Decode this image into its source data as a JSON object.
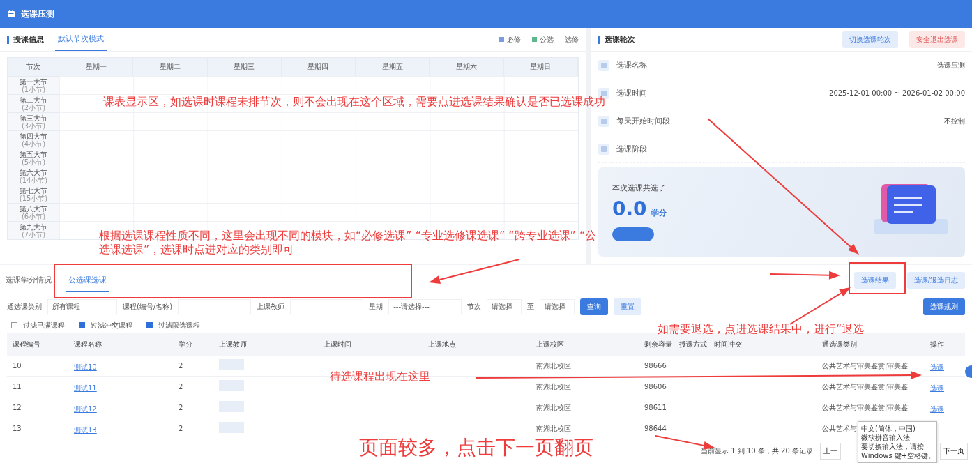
{
  "app": {
    "title": "选课压测"
  },
  "schedule": {
    "title": "授课信息",
    "tabs": [
      {
        "label": "默认节次模式",
        "selected": true
      }
    ],
    "legend": [
      {
        "label": "必修",
        "color": "#7b9be0"
      },
      {
        "label": "公选",
        "color": "#5cb88a"
      }
    ],
    "legend_extra": "选修",
    "corner": "节次",
    "days": [
      "星期一",
      "星期二",
      "星期三",
      "星期四",
      "星期五",
      "星期六",
      "星期日"
    ],
    "periods": [
      {
        "name": "第一大节",
        "sub": "(1小节)"
      },
      {
        "name": "第二大节",
        "sub": "(2小节)"
      },
      {
        "name": "第三大节",
        "sub": "(3小节)"
      },
      {
        "name": "第四大节",
        "sub": "(4小节)"
      },
      {
        "name": "第五大节",
        "sub": "(5小节)"
      },
      {
        "name": "第六大节",
        "sub": "(14小节)"
      },
      {
        "name": "第七大节",
        "sub": "(15小节)"
      },
      {
        "name": "第八大节",
        "sub": "(6小节)"
      },
      {
        "name": "第九大节",
        "sub": "(7小节)"
      }
    ]
  },
  "round": {
    "title": "选课轮次",
    "buttons": [
      {
        "label": "切换选课轮次",
        "kind": "primary"
      },
      {
        "label": "安全退出选课",
        "kind": "danger"
      }
    ],
    "info": [
      {
        "label": "选课名称",
        "value": "选课压测"
      },
      {
        "label": "选课时间",
        "value": "2025-12-01 00:00 ~ 2026-01-02 00:00"
      },
      {
        "label": "每天开始时间段",
        "value": "不控制"
      },
      {
        "label": "选课阶段"
      }
    ],
    "summary": {
      "caption": "本次选课共选了",
      "credits": "0.0",
      "unit": "学分"
    }
  },
  "course_selection": {
    "tabs": [
      {
        "label": "选课学分情况",
        "selected": false
      },
      {
        "label": "公选课选课",
        "selected": true
      }
    ],
    "actions": [
      "选课结果",
      "选课/退选日志"
    ],
    "filters": [
      {
        "kind": "select",
        "label": "通选课类别",
        "value": "所有课程"
      },
      {
        "kind": "input",
        "label": "课程(编号/名称)"
      },
      {
        "kind": "input",
        "label": "上课教师"
      },
      {
        "kind": "select",
        "label": "星期",
        "value": "---请选择---"
      },
      {
        "kind": "range",
        "label": "节次",
        "from": "请选择",
        "separator": "至",
        "to": "请选择"
      }
    ],
    "query": "查询",
    "reset": "重置",
    "rules": "选课规则",
    "checks": [
      {
        "label": "过滤已满课程",
        "checked": false
      },
      {
        "label": "过滤冲突课程",
        "checked": true
      },
      {
        "label": "过滤限选课程",
        "checked": true
      }
    ],
    "columns": [
      "课程编号",
      "课程名称",
      "学分",
      "上课教师",
      "上课时间",
      "上课地点",
      "上课校区",
      "剩余容量",
      "授课方式",
      "时间冲突",
      "通选课类别",
      "操作"
    ],
    "rows": [
      {
        "code": "10",
        "name": "测试10",
        "credit": "2",
        "campus": "南湖北校区",
        "remaining": "98666",
        "category": "公共艺术与审美鉴赏|审美鉴",
        "action": "选课"
      },
      {
        "code": "11",
        "name": "测试11",
        "credit": "2",
        "campus": "南湖北校区",
        "remaining": "98606",
        "category": "公共艺术与审美鉴赏|审美鉴",
        "action": "选课"
      },
      {
        "code": "12",
        "name": "测试12",
        "credit": "2",
        "campus": "南湖北校区",
        "remaining": "98611",
        "category": "公共艺术与审美鉴赏|审美鉴",
        "action": "选课"
      },
      {
        "code": "13",
        "name": "测试13",
        "credit": "2",
        "campus": "南湖北校区",
        "remaining": "98644",
        "category": "公共艺术与"
      }
    ],
    "pagination": {
      "summary": "当前显示 1 到 10 条，共 20 条记录",
      "prev": "上一",
      "next": "下一页"
    }
  },
  "ime_tooltip": {
    "lines": [
      "中文(简体，中国)",
      "微软拼音输入法",
      "要切换输入法，请按",
      "Windows 键+空格键。"
    ]
  },
  "annotations": [
    "课表显示区，如选课时课程未排节次，则不会出现在这个区域，需要点进选课结果确认是否已选课成功",
    "根据选课课程性质不同，这里会出现不同的模块，如“必修选课” “专业选修课选课” “跨专业选课” “公选课选课”，选课时点进对应的类别即可",
    "如需要退选，点进选课结果中，进行“退选",
    "待选课程出现在这里",
    "页面较多，点击下一页翻页"
  ]
}
